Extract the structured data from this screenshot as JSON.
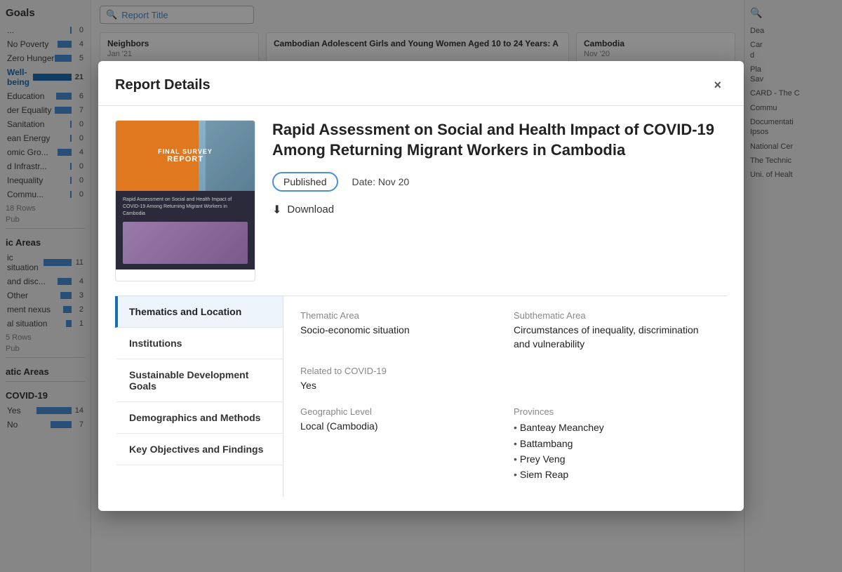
{
  "background": {
    "search_placeholder": "Report Title",
    "left_panel": {
      "title": "Goals",
      "rows": [
        {
          "label": "...",
          "value": 0,
          "bar": 0
        },
        {
          "label": "No Poverty",
          "value": 4,
          "bar": 30
        },
        {
          "label": "Zero Hunger",
          "value": 5,
          "bar": 36
        },
        {
          "label": "Well-being",
          "value": 21,
          "bar": 100,
          "highlighted": true
        },
        {
          "label": "Education",
          "value": 6,
          "bar": 40
        },
        {
          "label": "der Equality",
          "value": 7,
          "bar": 46
        },
        {
          "label": "Sanitation",
          "value": 0,
          "bar": 0
        },
        {
          "label": "ean Energy",
          "value": 0,
          "bar": 0
        },
        {
          "label": "omic Gro...",
          "value": 4,
          "bar": 30
        },
        {
          "label": "d Infrastr...",
          "value": 0,
          "bar": 0
        },
        {
          "label": "d Inequality",
          "value": 0,
          "bar": 0
        },
        {
          "label": "Commu...",
          "value": 0,
          "bar": 0
        }
      ],
      "rows_count": "18 Rows",
      "rows_label": "Pub"
    },
    "left_panel2": {
      "title": "ic Areas",
      "rows": [
        {
          "label": "ic situation",
          "value": 11,
          "bar": 80
        },
        {
          "label": "and disc...",
          "value": 4,
          "bar": 30
        },
        {
          "label": "Other",
          "value": 3,
          "bar": 24
        },
        {
          "label": "ment nexus",
          "value": 2,
          "bar": 16
        },
        {
          "label": "al situation",
          "value": 1,
          "bar": 10
        }
      ],
      "rows_count": "5 Rows",
      "rows_label": "Pub"
    },
    "left_panel3": {
      "title": "atic Areas"
    },
    "covid_section": {
      "title": "COVID-19",
      "rows": [
        {
          "label": "Yes",
          "value": 14,
          "bar": 90
        },
        {
          "label": "No",
          "value": 7,
          "bar": 50
        }
      ]
    },
    "right_panel": {
      "cards": [
        {
          "title": "Dea",
          "sub": ""
        },
        {
          "title": "Car",
          "sub": "d"
        },
        {
          "title": "Pla",
          "sub": "Sav"
        },
        {
          "title": "CARD - The C",
          "sub": ""
        },
        {
          "title": "Commu",
          "sub": ""
        },
        {
          "title": "Documentati",
          "sub": "Ipsos"
        },
        {
          "title": "National Cer",
          "sub": ""
        },
        {
          "title": "The Technic",
          "sub": ""
        },
        {
          "title": "Uni. of Healt",
          "sub": ""
        }
      ]
    },
    "bottom_cards": [
      {
        "title": "Neighbors",
        "date": "Jan '21"
      },
      {
        "title": "Cambodian Adolescent Girls and Young Women Aged 10 to 24 Years: A",
        "date": ""
      },
      {
        "title": "Cambodia",
        "date": "Nov '20"
      }
    ]
  },
  "modal": {
    "title": "Report Details",
    "close_label": "×",
    "report": {
      "title": "Rapid Assessment on Social and Health Impact of COVID-19 Among Returning Migrant Workers in Cambodia",
      "cover": {
        "line1": "FINAL SURVEY",
        "line2": "REPORT",
        "body_text": "Rapid Assessment on Social and Health Impact of COVID-19 Among Returning Migrant Workers in Cambodia"
      },
      "status": "Published",
      "date_label": "Date: Nov 20",
      "download_label": "Download"
    },
    "nav_items": [
      {
        "id": "thematics",
        "label": "Thematics and Location",
        "active": true
      },
      {
        "id": "institutions",
        "label": "Institutions",
        "active": false
      },
      {
        "id": "sdg",
        "label": "Sustainable Development Goals",
        "active": false
      },
      {
        "id": "demographics",
        "label": "Demographics and Methods",
        "active": false
      },
      {
        "id": "objectives",
        "label": "Key Objectives and Findings",
        "active": false
      }
    ],
    "details": {
      "thematic_area_label": "Thematic Area",
      "thematic_area_value": "Socio-economic situation",
      "subthematic_area_label": "Subthematic Area",
      "subthematic_area_value": "Circumstances of inequality, discrimination and vulnerability",
      "covid_label": "Related to COVID-19",
      "covid_value": "Yes",
      "geographic_label": "Geographic Level",
      "geographic_value": "Local (Cambodia)",
      "provinces_label": "Provinces",
      "provinces": [
        "Banteay Meanchey",
        "Battambang",
        "Prey Veng",
        "Siem Reap"
      ]
    }
  }
}
